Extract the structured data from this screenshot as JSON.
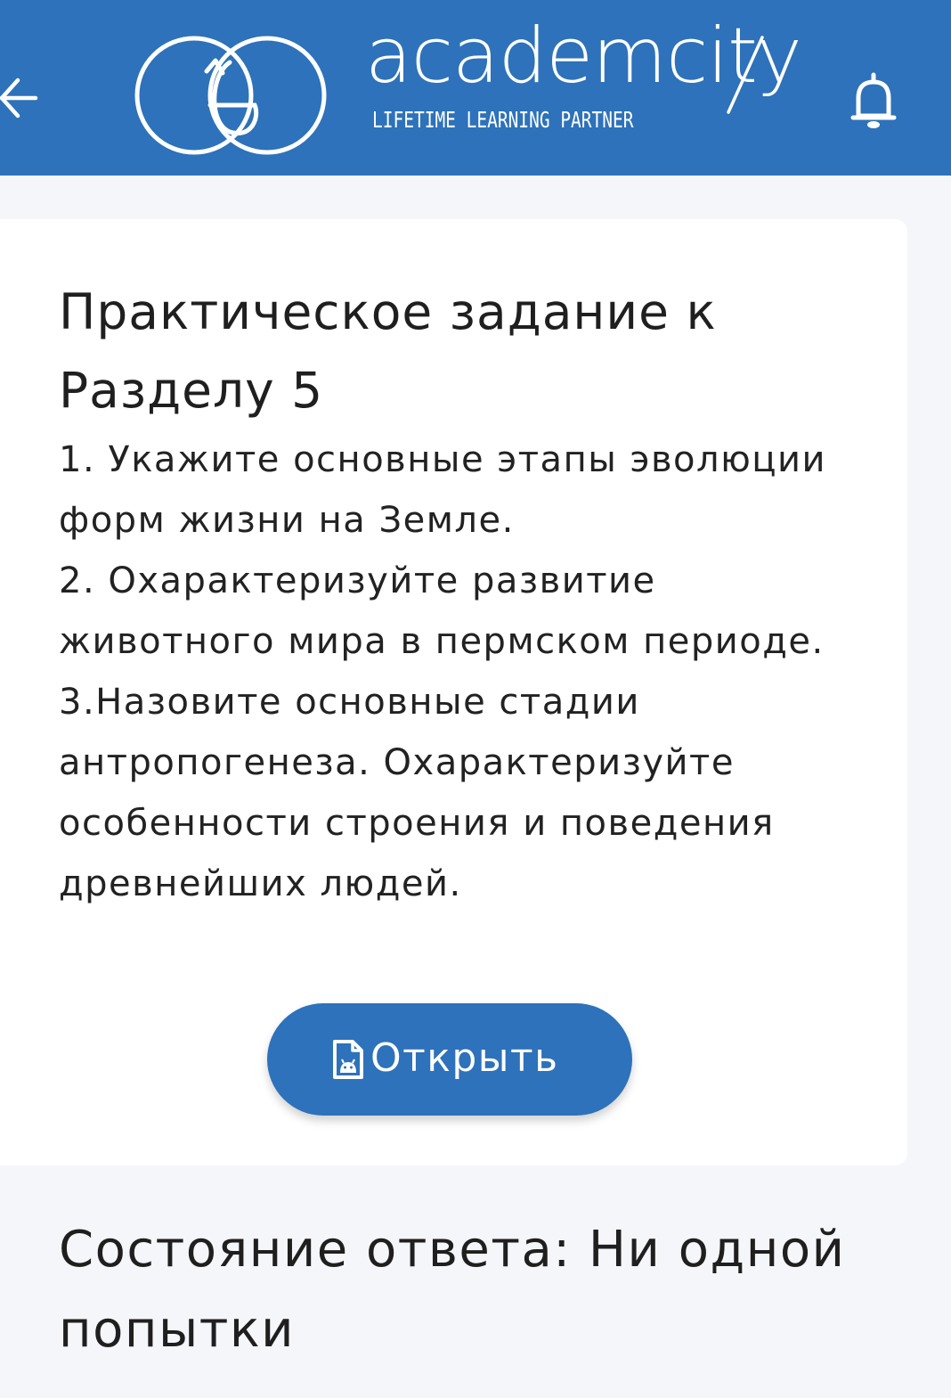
{
  "header": {
    "brand_name": "academcity",
    "tagline": "LIFETIME LEARNING PARTNER",
    "background_color": "#2d72ba",
    "back_icon": "arrow-left-icon",
    "logo_icon": "academcity-logo-mark",
    "notification_icon": "bell-icon"
  },
  "task_card": {
    "title": "Практическое задание к Разделу 5",
    "body": "1. Укажите основные этапы эволюции форм жизни на Земле.\n2. Охарактеризуйте развитие животного мира в пермском периоде.\n3.Назовите основные стадии антропогенеза. Охарактеризуйте особенности строения и поведения древнейших людей.",
    "open_button": {
      "label": "Открыть",
      "icon": "android-file-icon",
      "color": "#2d72ba"
    }
  },
  "answer_status": {
    "text": "Состояние ответа: Ни одной попытки"
  }
}
